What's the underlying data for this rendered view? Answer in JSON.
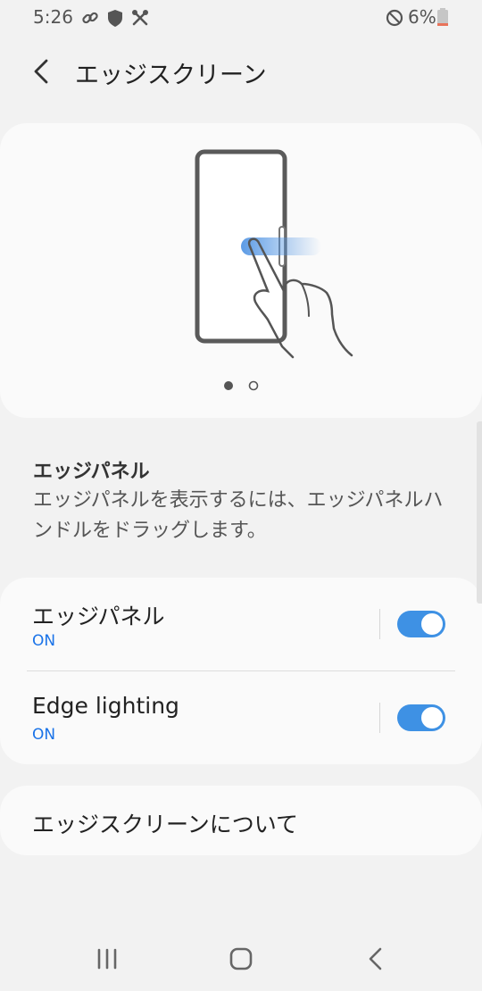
{
  "status_bar": {
    "time": "5:26",
    "battery_percent": "6%",
    "icons": [
      "link-icon",
      "shield-icon",
      "tools-icon",
      "do-not-disturb-icon",
      "battery-icon"
    ]
  },
  "header": {
    "title": "エッジスクリーン",
    "back_icon": "back-arrow-icon"
  },
  "illustration": {
    "page_count": 2,
    "current_page": 1
  },
  "description": {
    "title": "エッジパネル",
    "body": "エッジパネルを表示するには、エッジパネルハンドルをドラッグします。"
  },
  "settings": [
    {
      "title": "エッジパネル",
      "status": "ON",
      "enabled": true
    },
    {
      "title": "Edge lighting",
      "status": "ON",
      "enabled": true
    }
  ],
  "about": {
    "label": "エッジスクリーンについて"
  },
  "colors": {
    "accent": "#3e91e4",
    "status_text": "#1a73e8",
    "background": "#f2f2f2",
    "card": "#fafafa"
  },
  "nav_bar": {
    "icons": [
      "recent-apps-icon",
      "home-icon",
      "back-icon"
    ]
  }
}
